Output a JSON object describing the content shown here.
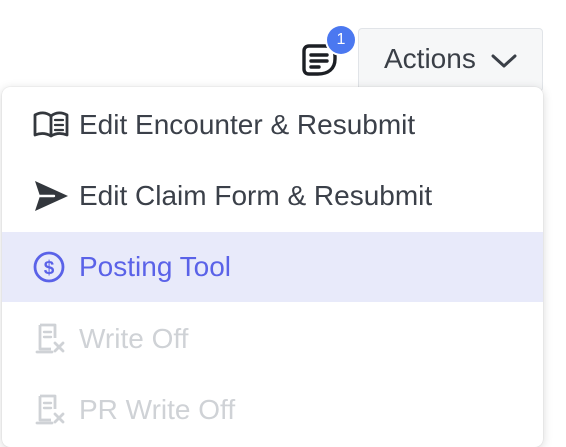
{
  "header": {
    "notes_icon": "note-icon",
    "notes_badge_count": "1",
    "actions_label": "Actions",
    "actions_chevron_icon": "chevron-down-icon"
  },
  "menu": {
    "items": [
      {
        "label": "Edit Encounter & Resubmit",
        "icon": "open-book-icon",
        "state": "enabled"
      },
      {
        "label": "Edit Claim Form & Resubmit",
        "icon": "send-icon",
        "state": "enabled"
      },
      {
        "label": "Posting Tool",
        "icon": "dollar-circle-icon",
        "state": "highlighted"
      },
      {
        "label": "Write Off",
        "icon": "receipt-x-icon",
        "state": "disabled"
      },
      {
        "label": "PR Write Off",
        "icon": "receipt-x-icon",
        "state": "disabled"
      }
    ]
  },
  "colors": {
    "accent": "#5a62e8",
    "badge": "#4b78f0",
    "highlight_bg": "#e8eafa",
    "text": "#3b4049",
    "disabled_text": "#cfd2d6"
  }
}
